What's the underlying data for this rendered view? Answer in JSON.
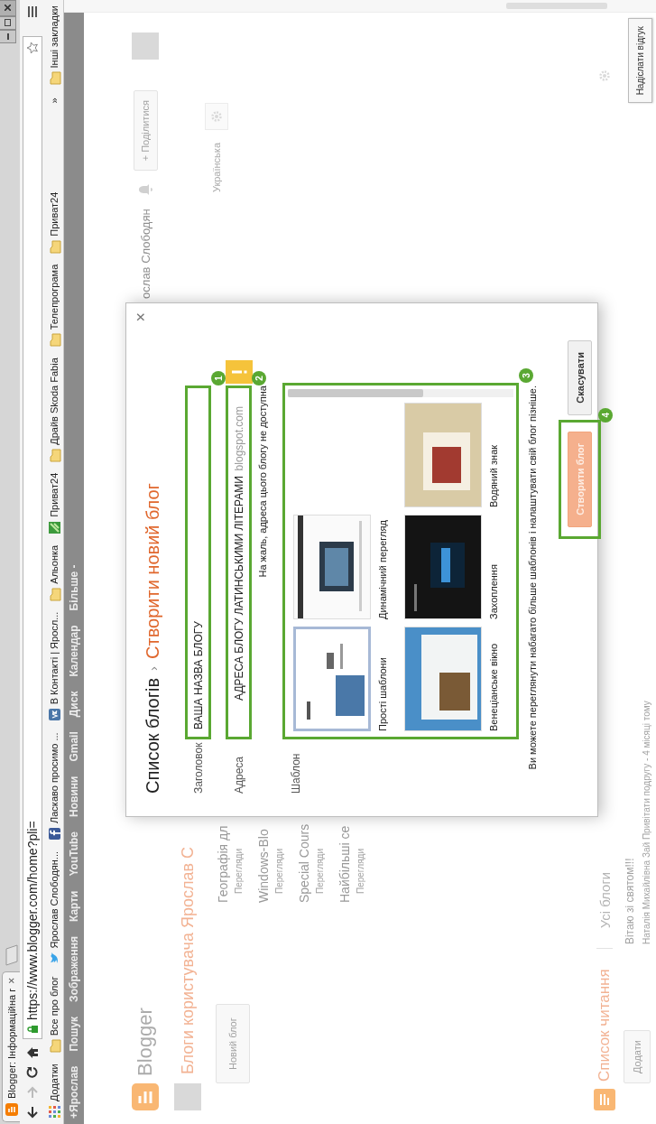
{
  "browser": {
    "tab_title": "Blogger: Інформаційна г",
    "tab_close": "×",
    "url": "https://www.blogger.com/home?pli=",
    "bookmarks": [
      {
        "label": "Додатки",
        "kind": "apps"
      },
      {
        "label": "Все про блог",
        "kind": "folder"
      },
      {
        "label": "Ярослав Слободян...",
        "kind": "twitter"
      },
      {
        "label": "Ласкаво просимо ...",
        "kind": "facebook"
      },
      {
        "label": "В Контакті | Яросл...",
        "kind": "vk"
      },
      {
        "label": "Альонка",
        "kind": "folder"
      },
      {
        "label": "Приват24",
        "kind": "privat"
      },
      {
        "label": "Драйв Skoda Fabia",
        "kind": "folder"
      },
      {
        "label": "Телепрограма",
        "kind": "folder"
      },
      {
        "label": "Приват24",
        "kind": "folder"
      }
    ],
    "more_bookmarks": "»",
    "other_bookmarks": "Інші закладки"
  },
  "page": {
    "google_bar": [
      "+Ярослав",
      "Пошук",
      "Зображення",
      "Карти",
      "YouTube",
      "Новини",
      "Gmail",
      "Диск",
      "Календар",
      "Більше -"
    ],
    "logo": "Blogger",
    "user_name": "ослав Слободян",
    "share_button": "+ Поділитися",
    "language": "Українська",
    "blogs_heading": "Блоги користувача Ярослав С",
    "new_blog_button": "Новий блог",
    "blogs": [
      {
        "title": "Географія дл",
        "meta": "Перегляди"
      },
      {
        "title": "Windows-Blo",
        "meta": "Перегляди"
      },
      {
        "title": "Special Cours",
        "meta": "Перегляди"
      },
      {
        "title": "Найбільші се",
        "meta": "Перегляди"
      }
    ],
    "reading_heading": "Список читання",
    "reading_tab": "Усі блоги",
    "add_button": "Додати",
    "posts": [
      {
        "title": "Вітаю зі святом!!!",
        "meta": "Наталія Михайлівна Зай Привітати подругу - 4 місяці тому"
      }
    ],
    "feedback_button": "Надіслати відгук"
  },
  "dialog": {
    "breadcrumb": {
      "parent": "Список блогів",
      "separator": "›",
      "current": "Створити новий блог"
    },
    "close": "×",
    "title_field": {
      "label": "Заголовок",
      "value": "ВАША НАЗВА БЛОГУ",
      "highlighted": true,
      "marker": "1"
    },
    "address_field": {
      "label": "Адреса",
      "value": "АДРЕСА БЛОГУ ЛАТИНСЬКИМИ ЛІТЕРАМИ",
      "suffix": "blogspot.com",
      "warning": true,
      "highlighted": true,
      "marker": "2",
      "error": "На жаль, адреса цього блогу не доступна"
    },
    "template": {
      "label": "Шаблон",
      "highlighted": true,
      "marker": "3",
      "items": [
        {
          "name": "Прості шаблони",
          "kind": "simple",
          "selected": true
        },
        {
          "name": "Динамічний перегляд",
          "kind": "dynamic",
          "selected": false
        },
        {
          "name": "Венеціанське вікно",
          "kind": "window",
          "selected": false
        },
        {
          "name": "Захоплення",
          "kind": "dark",
          "selected": false
        },
        {
          "name": "Водяний знак",
          "kind": "watermark",
          "selected": false
        }
      ]
    },
    "hint": "Ви можете переглянути набагато більше шаблонів і налаштувати свій блог пізніше.",
    "buttons": [
      {
        "label": "Створити блог",
        "kind": "primary",
        "disabled": true,
        "highlighted": true,
        "marker": "4"
      },
      {
        "label": "Скасувати",
        "kind": "secondary",
        "disabled": false,
        "highlighted": false
      }
    ]
  }
}
